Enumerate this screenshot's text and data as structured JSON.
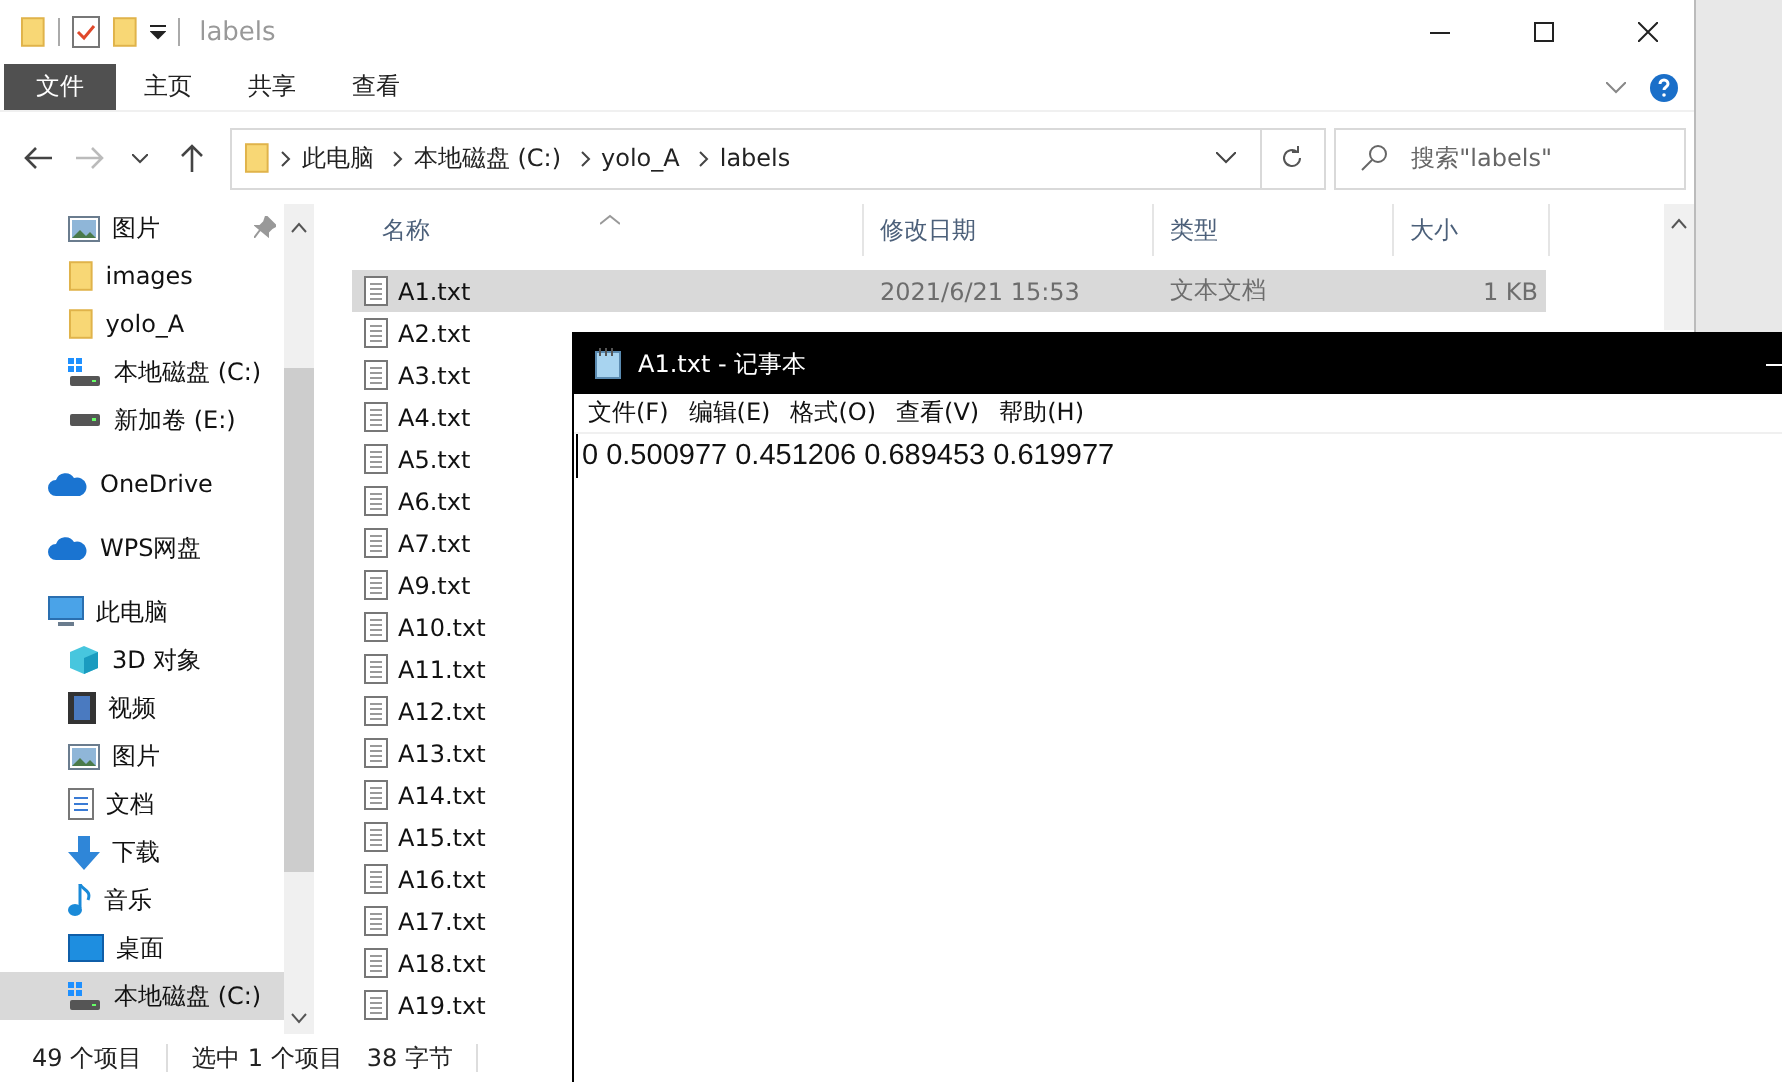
{
  "window": {
    "title": "labels"
  },
  "ribbon": {
    "tabs": [
      {
        "label": "文件",
        "selected": true
      },
      {
        "label": "主页",
        "selected": false
      },
      {
        "label": "共享",
        "selected": false
      },
      {
        "label": "查看",
        "selected": false
      }
    ]
  },
  "address": {
    "breadcrumbs": [
      "此电脑",
      "本地磁盘 (C:)",
      "yolo_A",
      "labels"
    ],
    "search": {
      "placeholder": "搜索\"labels\""
    }
  },
  "sidebar": {
    "quick_access": [
      {
        "label": "图片",
        "kind": "picture",
        "pinned": true,
        "selected": false
      },
      {
        "label": "images",
        "kind": "folder",
        "pinned": false,
        "selected": false
      },
      {
        "label": "yolo_A",
        "kind": "folder",
        "pinned": false,
        "selected": false
      },
      {
        "label": "本地磁盘 (C:)",
        "kind": "system-drive",
        "pinned": false,
        "selected": false
      },
      {
        "label": "新加卷 (E:)",
        "kind": "drive",
        "pinned": false,
        "selected": false
      }
    ],
    "locations": [
      {
        "label": "OneDrive",
        "kind": "cloud",
        "selected": false
      },
      {
        "label": "WPS网盘",
        "kind": "cloud",
        "selected": false
      },
      {
        "label": "此电脑",
        "kind": "pc",
        "selected": false,
        "children": [
          {
            "label": "3D 对象",
            "kind": "cube",
            "selected": false
          },
          {
            "label": "视频",
            "kind": "video",
            "selected": false
          },
          {
            "label": "图片",
            "kind": "picture",
            "selected": false
          },
          {
            "label": "文档",
            "kind": "document",
            "selected": false
          },
          {
            "label": "下载",
            "kind": "download",
            "selected": false
          },
          {
            "label": "音乐",
            "kind": "music",
            "selected": false
          },
          {
            "label": "桌面",
            "kind": "desktop",
            "selected": false
          },
          {
            "label": "本地磁盘 (C:)",
            "kind": "system-drive",
            "selected": true
          }
        ]
      }
    ]
  },
  "files": {
    "columns": [
      "名称",
      "修改日期",
      "类型",
      "大小"
    ],
    "rows": [
      {
        "name": "A1.txt",
        "modified": "2021/6/21 15:53",
        "type": "文本文档",
        "size": "1 KB",
        "selected": true
      },
      {
        "name": "A2.txt",
        "selected": false
      },
      {
        "name": "A3.txt",
        "selected": false
      },
      {
        "name": "A4.txt",
        "selected": false
      },
      {
        "name": "A5.txt",
        "selected": false
      },
      {
        "name": "A6.txt",
        "selected": false
      },
      {
        "name": "A7.txt",
        "selected": false
      },
      {
        "name": "A9.txt",
        "selected": false
      },
      {
        "name": "A10.txt",
        "selected": false
      },
      {
        "name": "A11.txt",
        "selected": false
      },
      {
        "name": "A12.txt",
        "selected": false
      },
      {
        "name": "A13.txt",
        "selected": false
      },
      {
        "name": "A14.txt",
        "selected": false
      },
      {
        "name": "A15.txt",
        "selected": false
      },
      {
        "name": "A16.txt",
        "selected": false
      },
      {
        "name": "A17.txt",
        "selected": false
      },
      {
        "name": "A18.txt",
        "selected": false
      },
      {
        "name": "A19.txt",
        "selected": false
      }
    ]
  },
  "status_bar": {
    "item_count": "49 个项目",
    "selection": "选中 1 个项目",
    "selection_size": "38 字节"
  },
  "notepad": {
    "title": "A1.txt - 记事本",
    "menu": [
      "文件(F)",
      "编辑(E)",
      "格式(O)",
      "查看(V)",
      "帮助(H)"
    ],
    "content": "0 0.500977 0.451206 0.689453 0.619977"
  }
}
